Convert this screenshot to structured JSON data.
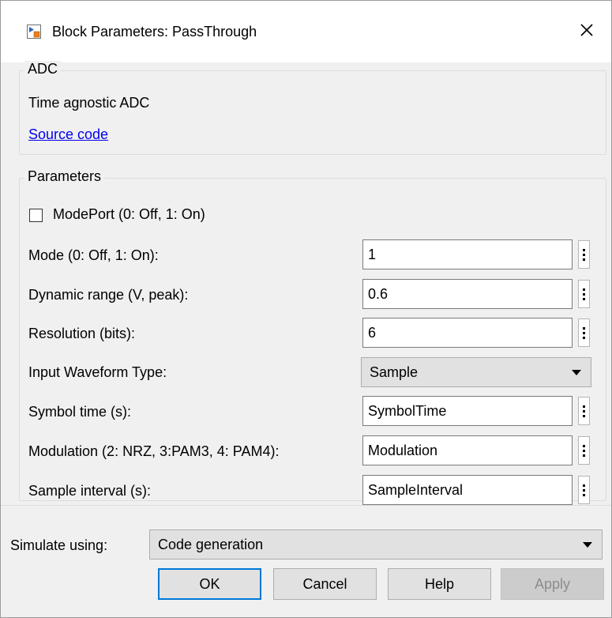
{
  "window": {
    "title": "Block Parameters: PassThrough"
  },
  "adc_group": {
    "label": "ADC",
    "description": "Time agnostic ADC",
    "source_link": "Source code"
  },
  "params_group": {
    "label": "Parameters",
    "modeport_label": "ModePort (0: Off, 1: On)",
    "modeport_checked": false,
    "mode_label": "Mode (0: Off, 1: On):",
    "mode_value": "1",
    "dynrange_label": "Dynamic range (V, peak):",
    "dynrange_value": "0.6",
    "resolution_label": "Resolution (bits):",
    "resolution_value": "6",
    "waveform_label": "Input Waveform Type:",
    "waveform_value": "Sample",
    "symboltime_label": "Symbol time (s):",
    "symboltime_value": "SymbolTime",
    "modulation_label": "Modulation (2: NRZ, 3:PAM3, 4: PAM4):",
    "modulation_value": "Modulation",
    "sampleinterval_label": "Sample interval (s):",
    "sampleinterval_value": "SampleInterval"
  },
  "simulate": {
    "label": "Simulate using:",
    "value": "Code generation"
  },
  "buttons": {
    "ok": "OK",
    "cancel": "Cancel",
    "help": "Help",
    "apply": "Apply"
  },
  "colors": {
    "accent": "#0078d7",
    "link": "#0000ee",
    "disabled_text": "#8c8c8c"
  }
}
